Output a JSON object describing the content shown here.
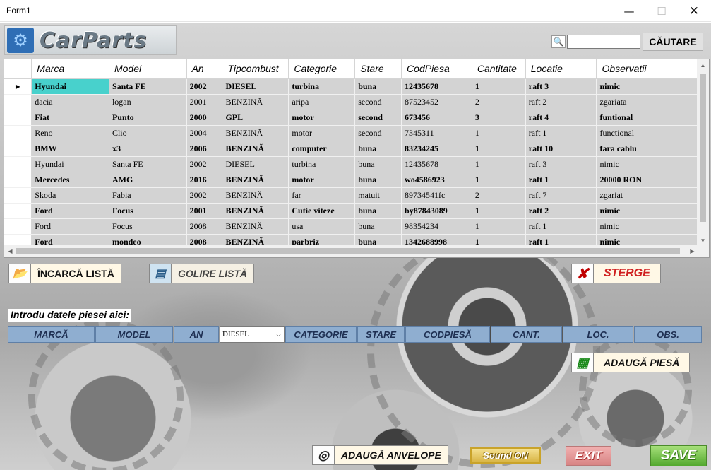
{
  "window": {
    "title": "Form1",
    "min": "—",
    "max": "☐",
    "close": "✕"
  },
  "header": {
    "logo_text": "CarParts",
    "search_value": "",
    "search_button": "CĂUTARE"
  },
  "grid": {
    "columns": [
      "Marca",
      "Model",
      "An",
      "Tipcombust",
      "Categorie",
      "Stare",
      "CodPiesa",
      "Cantitate",
      "Locatie",
      "Observatii"
    ],
    "rows": [
      {
        "bold": true,
        "cells": [
          "Hyundai",
          "Santa FE",
          "2002",
          "DIESEL",
          "turbina",
          "buna",
          "12435678",
          "1",
          "raft 3",
          "nimic"
        ]
      },
      {
        "bold": false,
        "cells": [
          "dacia",
          "logan",
          "2001",
          "BENZINĂ",
          "aripa",
          "second",
          "87523452",
          "2",
          "raft 2",
          "zgariata"
        ]
      },
      {
        "bold": true,
        "cells": [
          "Fiat",
          "Punto",
          "2000",
          "GPL",
          "motor",
          "second",
          "673456",
          "3",
          "raft 4",
          "funtional"
        ]
      },
      {
        "bold": false,
        "cells": [
          "Reno",
          "Clio",
          "2004",
          "BENZINĂ",
          "motor",
          "second",
          "7345311",
          "1",
          "raft 1",
          "functional"
        ]
      },
      {
        "bold": true,
        "cells": [
          "BMW",
          "x3",
          "2006",
          "BENZINĂ",
          "computer",
          "buna",
          "83234245",
          "1",
          "raft 10",
          "fara cablu"
        ]
      },
      {
        "bold": false,
        "cells": [
          " Hyundai",
          "Santa FE",
          "2002",
          "DIESEL",
          "turbina",
          "buna",
          "12435678",
          "1",
          "raft 3",
          "nimic"
        ]
      },
      {
        "bold": true,
        "cells": [
          "Mercedes",
          "AMG",
          "2016",
          "BENZINĂ",
          "motor",
          "buna",
          "wo4586923",
          "1",
          "raft 1",
          "20000 RON"
        ]
      },
      {
        "bold": false,
        "cells": [
          "Skoda",
          "Fabia",
          "2002",
          "BENZINĂ",
          "far",
          "matuit",
          "89734541fc",
          "2",
          "raft 7",
          "zgariat"
        ]
      },
      {
        "bold": true,
        "cells": [
          "Ford",
          "Focus",
          "2001",
          "BENZINĂ",
          "Cutie viteze",
          "buna",
          "by87843089",
          "1",
          "raft 2",
          "nimic"
        ]
      },
      {
        "bold": false,
        "cells": [
          "Ford",
          "Focus",
          "2008",
          "BENZINĂ",
          "usa",
          "buna",
          "98354234",
          "1",
          "raft 1",
          "nimic"
        ]
      },
      {
        "bold": true,
        "cells": [
          "Ford",
          "mondeo",
          "2008",
          "BENZINĂ",
          "parbriz",
          "buna",
          "1342688998",
          "1",
          "raft 1",
          "nimic"
        ]
      }
    ]
  },
  "buttons": {
    "load_list": "ÎNCARCĂ LISTĂ",
    "clear_list": "GOLIRE LISTĂ",
    "delete": "STERGE",
    "add_part": "ADAUGĂ PIESĂ",
    "add_tires": "ADAUGĂ ANVELOPE",
    "sound": "Sound ON",
    "exit": "EXIT",
    "save": "SAVE"
  },
  "entry": {
    "intro": "Introdu datele piesei aici:",
    "marca": "MARCĂ",
    "model": "MODEL",
    "an": "AN",
    "fuel_selected": "DIESEL",
    "categorie": "CATEGORIE",
    "stare": "STARE",
    "codpiesa": "CODPIESĂ",
    "cant": "CANT.",
    "loc": "LOC.",
    "obs": "OBS."
  }
}
